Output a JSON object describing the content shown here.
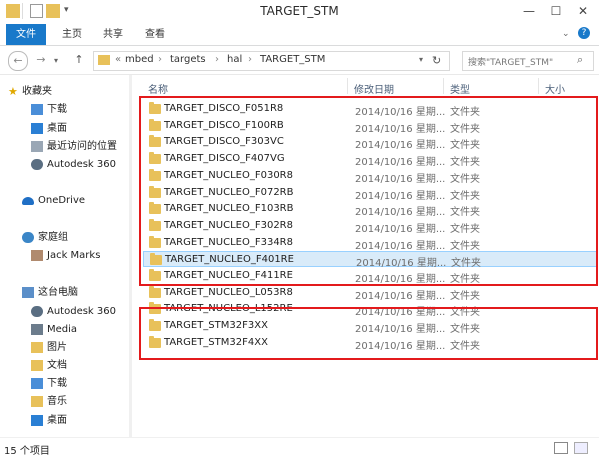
{
  "window": {
    "title": "TARGET_STM"
  },
  "ribbon": {
    "tabs": [
      "文件",
      "主页",
      "共享",
      "查看"
    ]
  },
  "address": {
    "overflow": "«",
    "crumbs": [
      "mbed",
      "targets",
      "hal",
      "TARGET_STM"
    ]
  },
  "search": {
    "placeholder": "搜索\"TARGET_STM\""
  },
  "columns": {
    "name": "名称",
    "date": "修改日期",
    "type": "类型",
    "size": "大小"
  },
  "nav": {
    "favorites": "收藏夹",
    "downloads": "下载",
    "desktop": "桌面",
    "recent": "最近访问的位置",
    "autodesk_fav": "Autodesk 360",
    "onedrive": "OneDrive",
    "homegroup": "家庭组",
    "jack": "Jack Marks",
    "thispc": "这台电脑",
    "autodesk_pc": "Autodesk 360",
    "media": "Media",
    "pictures": "图片",
    "documents": "文档",
    "downloads2": "下载",
    "music": "音乐",
    "desktop2": "桌面"
  },
  "files": [
    {
      "name": "TARGET_DISCO_F051R8",
      "date": "2014/10/16 星期...",
      "type": "文件夹"
    },
    {
      "name": "TARGET_DISCO_F100RB",
      "date": "2014/10/16 星期...",
      "type": "文件夹"
    },
    {
      "name": "TARGET_DISCO_F303VC",
      "date": "2014/10/16 星期...",
      "type": "文件夹"
    },
    {
      "name": "TARGET_DISCO_F407VG",
      "date": "2014/10/16 星期...",
      "type": "文件夹"
    },
    {
      "name": "TARGET_NUCLEO_F030R8",
      "date": "2014/10/16 星期...",
      "type": "文件夹"
    },
    {
      "name": "TARGET_NUCLEO_F072RB",
      "date": "2014/10/16 星期...",
      "type": "文件夹"
    },
    {
      "name": "TARGET_NUCLEO_F103RB",
      "date": "2014/10/16 星期...",
      "type": "文件夹"
    },
    {
      "name": "TARGET_NUCLEO_F302R8",
      "date": "2014/10/16 星期...",
      "type": "文件夹"
    },
    {
      "name": "TARGET_NUCLEO_F334R8",
      "date": "2014/10/16 星期...",
      "type": "文件夹"
    },
    {
      "name": "TARGET_NUCLEO_F401RE",
      "date": "2014/10/16 星期...",
      "type": "文件夹"
    },
    {
      "name": "TARGET_NUCLEO_F411RE",
      "date": "2014/10/16 星期...",
      "type": "文件夹"
    },
    {
      "name": "TARGET_NUCLEO_L053R8",
      "date": "2014/10/16 星期...",
      "type": "文件夹"
    },
    {
      "name": "TARGET_NUCLEO_L152RE",
      "date": "2014/10/16 星期...",
      "type": "文件夹"
    },
    {
      "name": "TARGET_STM32F3XX",
      "date": "2014/10/16 星期...",
      "type": "文件夹"
    },
    {
      "name": "TARGET_STM32F4XX",
      "date": "2014/10/16 星期...",
      "type": "文件夹"
    }
  ],
  "selected_index": 9,
  "status": {
    "count": "15 个项目"
  },
  "colors": {
    "accent": "#1979ca",
    "highlight": "#e31a1c",
    "folder": "#e8c15a"
  }
}
